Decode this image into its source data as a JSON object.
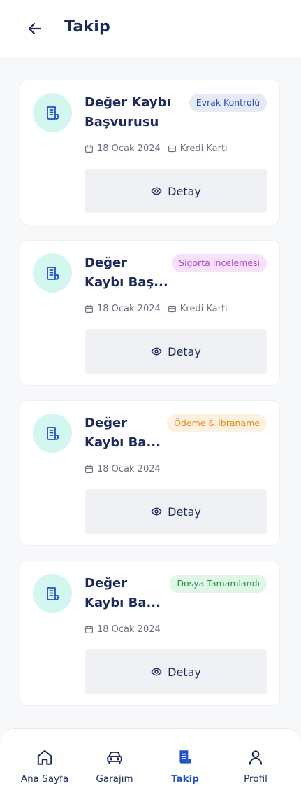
{
  "header": {
    "title": "Takip",
    "back_icon": "arrow-left-icon"
  },
  "colors": {
    "navy": "#1b2a5b",
    "accent": "#2150c8",
    "icon_bg": "#d3f6f0"
  },
  "cards": [
    {
      "title_line1": "Değer Kaybı",
      "title_line2": "Başvurusu",
      "status": "Evrak Kontrolü",
      "status_bg": "#e4eaf8",
      "status_color": "#2a4eb0",
      "date": "18 Ocak 2024",
      "payment": "Kredi Kartı",
      "detail_label": "Detay"
    },
    {
      "title_line1": "Değer",
      "title_line2": "Kaybı Baş...",
      "status": "Sigorta İncelemesi",
      "status_bg": "#f6e3fb",
      "status_color": "#b13fd0",
      "date": "18 Ocak 2024",
      "payment": "Kredi Kartı",
      "detail_label": "Detay"
    },
    {
      "title_line1": "Değer",
      "title_line2": "Kaybı Ba...",
      "status": "Ödeme & İbraname",
      "status_bg": "#fdf1e2",
      "status_color": "#e58a17",
      "date": "18 Ocak 2024",
      "detail_label": "Detay"
    },
    {
      "title_line1": "Değer",
      "title_line2": "Kaybı Ba...",
      "status": "Dosya Tamamlandı",
      "status_bg": "#e0f7e7",
      "status_color": "#1f8f47",
      "date": "18 Ocak 2024",
      "detail_label": "Detay"
    }
  ],
  "nav": {
    "items": [
      {
        "label": "Ana Sayfa",
        "icon": "home-icon",
        "active": false
      },
      {
        "label": "Garajım",
        "icon": "car-icon",
        "active": false
      },
      {
        "label": "Takip",
        "icon": "document-icon",
        "active": true
      },
      {
        "label": "Profil",
        "icon": "user-icon",
        "active": false
      }
    ]
  }
}
